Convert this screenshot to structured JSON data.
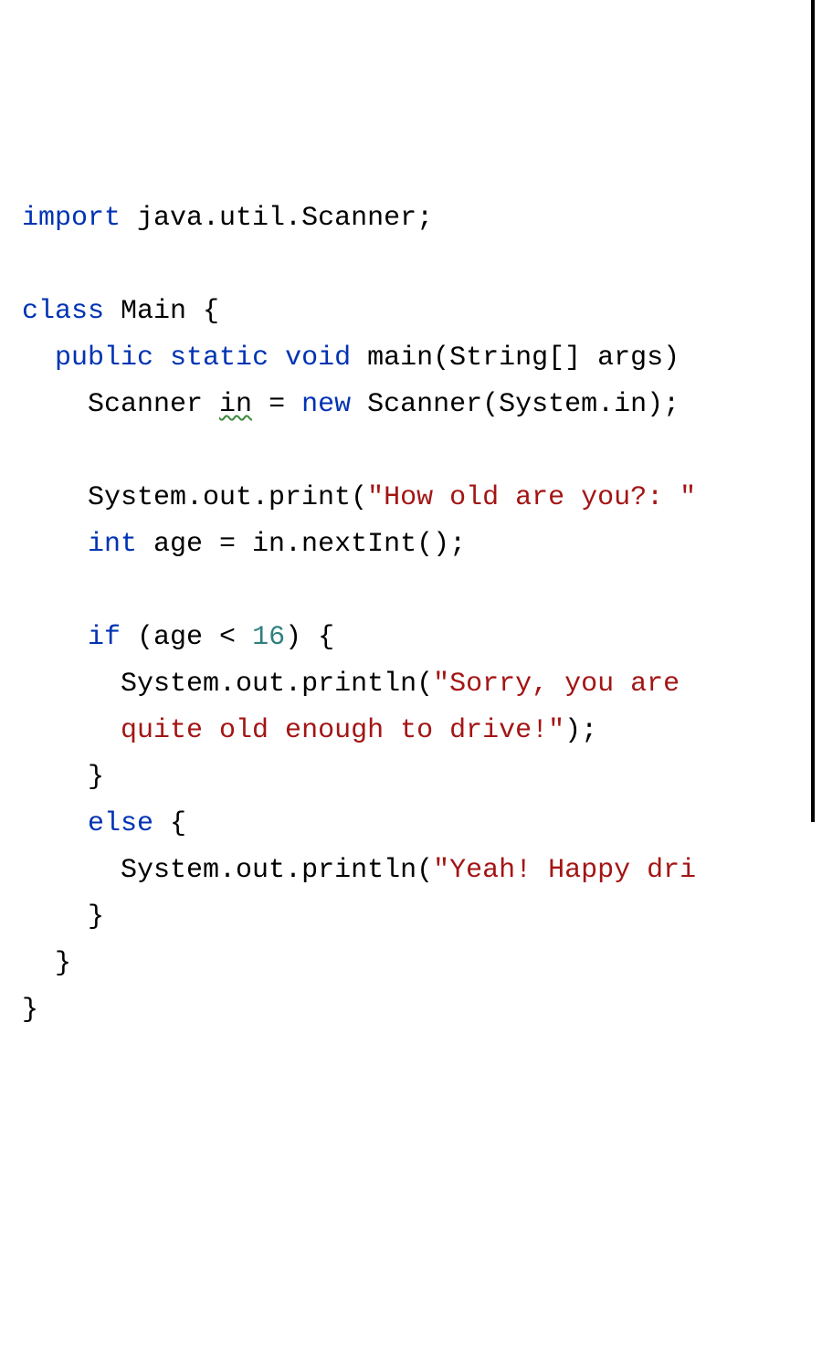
{
  "code": {
    "line1": {
      "import_kw": "import",
      "package": " java.util.Scanner;"
    },
    "line3": {
      "class_kw": "class",
      "name": " Main {"
    },
    "line4": {
      "public_kw": "public",
      "static_kw": " static",
      "void_kw": " void",
      "method": " main(String[] args)"
    },
    "line5": {
      "pre": "Scanner ",
      "var": "in",
      "assign": " = ",
      "new_kw": "new",
      "rest": " Scanner(System.in);"
    },
    "line7": {
      "pre": "System.out.print(",
      "str": "\"How old are you?: \"",
      "post": ""
    },
    "line8": {
      "int_kw": "int",
      "var": " age = in.nextInt();"
    },
    "line10": {
      "if_kw": "if",
      "pre": " (age < ",
      "num": "16",
      "post": ") {"
    },
    "line11": {
      "pre": "System.out.println(",
      "str": "\"Sorry, you are "
    },
    "line12": {
      "str": "quite old enough to drive!\"",
      "post": ");"
    },
    "line13": {
      "brace": "}"
    },
    "line14": {
      "else_kw": "else",
      "post": " {"
    },
    "line15": {
      "pre": "System.out.println(",
      "str": "\"Yeah! Happy dri"
    },
    "line16": {
      "brace": "}"
    },
    "line17": {
      "brace": "}"
    },
    "line18": {
      "brace": "}"
    }
  }
}
